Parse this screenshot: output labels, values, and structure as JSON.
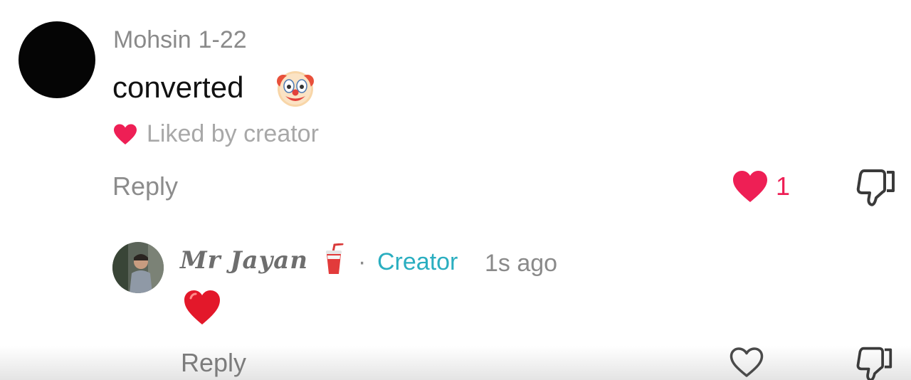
{
  "comment": {
    "username": "Mohsin",
    "date": "1-22",
    "text": "converted",
    "emoji_icon": "clown-face-icon",
    "liked_by_creator_label": "Liked by creator",
    "reply_label": "Reply",
    "like_count": "1",
    "liked": true,
    "colors": {
      "like_red": "#ee1f55",
      "muted_text": "#8a8a8a"
    }
  },
  "reply": {
    "username": "Mr Jayan",
    "username_emoji_icon": "cup-with-straw-icon",
    "separator": "·",
    "badge": "Creator",
    "time": "1s ago",
    "text_emoji_icon": "red-heart-icon",
    "reply_label": "Reply",
    "liked": false,
    "colors": {
      "creator_badge": "#2aaec0"
    }
  }
}
